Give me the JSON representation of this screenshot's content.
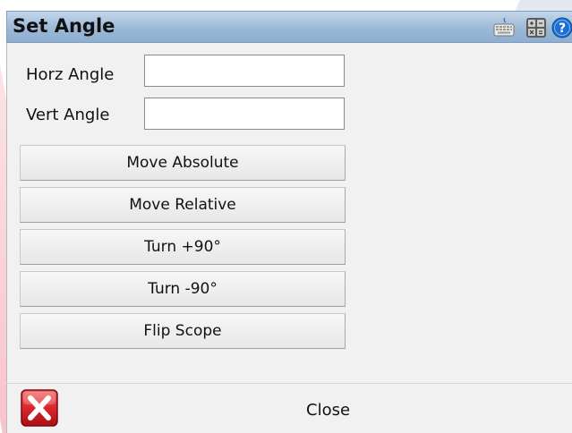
{
  "window": {
    "title": "Set Angle"
  },
  "toolbar": {
    "keyboard_icon": "keyboard-icon",
    "calculator_icon": "calculator-icon",
    "help_icon": "help-icon"
  },
  "form": {
    "horz_label": "Horz Angle",
    "horz_value": "",
    "vert_label": "Vert Angle",
    "vert_value": ""
  },
  "buttons": {
    "move_absolute": "Move Absolute",
    "move_relative": "Move Relative",
    "turn_plus_90": "Turn +90°",
    "turn_minus_90": "Turn -90°",
    "flip_scope": "Flip Scope"
  },
  "footer": {
    "close_label": "Close",
    "close_icon": "close-icon"
  },
  "colors": {
    "titlebar": "#9bb9d7",
    "panel": "#f1f1f1",
    "close_red": "#d9262b"
  }
}
